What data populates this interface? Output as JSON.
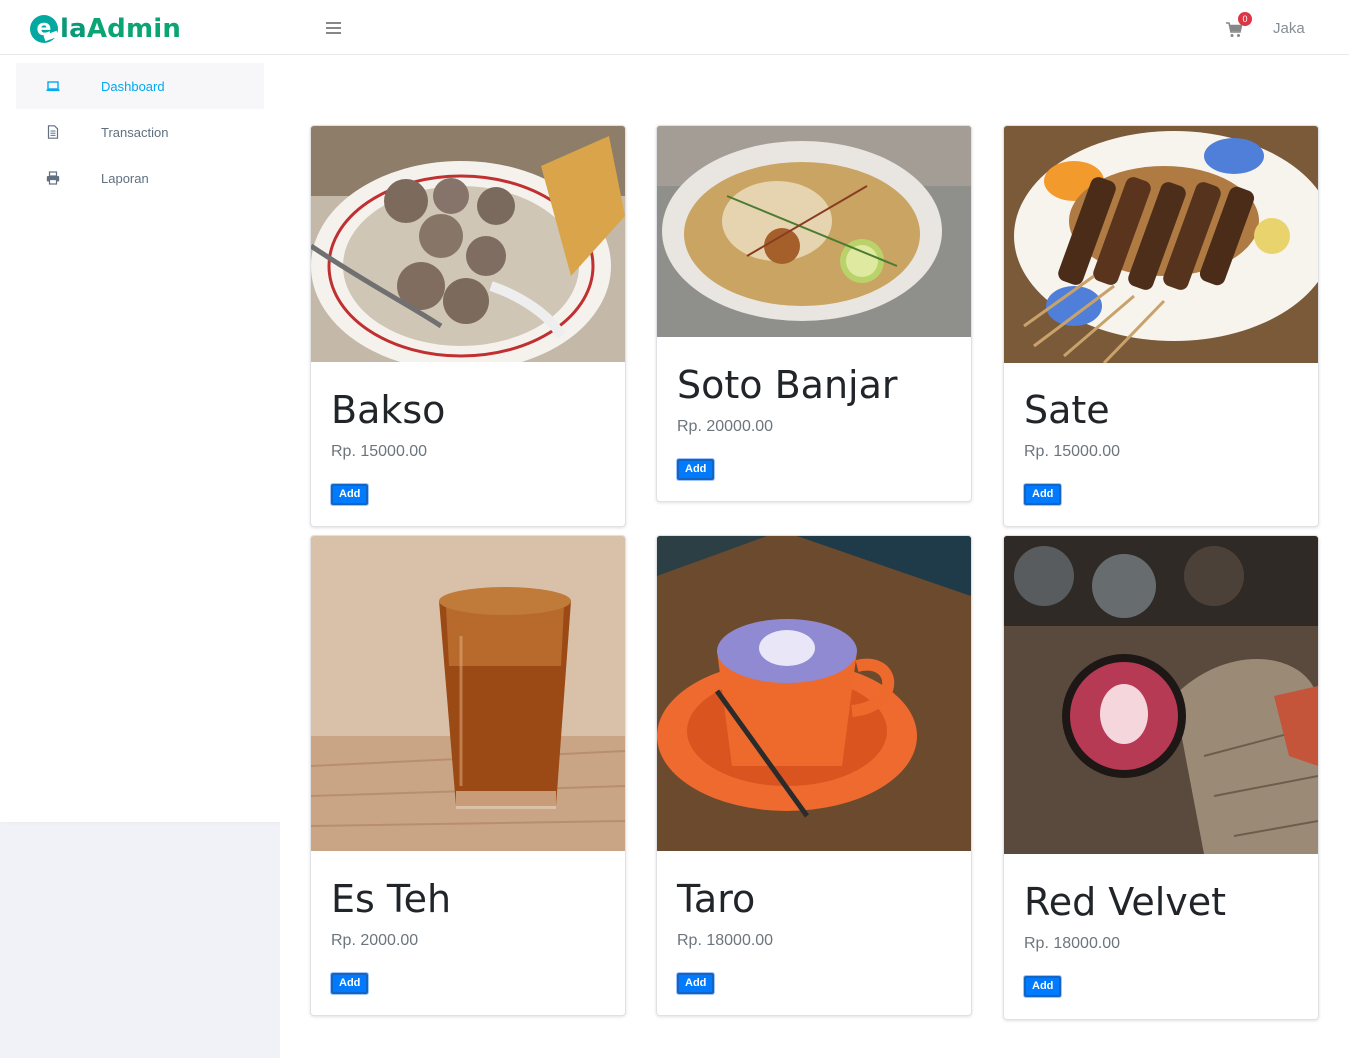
{
  "app": {
    "brand": {
      "e": "e",
      "la": "la",
      "admin": "Admin"
    }
  },
  "header": {
    "cart_count": "0",
    "user_name": "Jaka",
    "icons": [
      "menu-icon",
      "cart-icon"
    ]
  },
  "sidebar": {
    "items": [
      {
        "label": "Dashboard",
        "icon": "laptop-icon",
        "active": true
      },
      {
        "label": "Transaction",
        "icon": "file-text-icon",
        "active": false
      },
      {
        "label": "Laporan",
        "icon": "printer-icon",
        "active": false
      }
    ]
  },
  "products": [
    {
      "name": "Bakso",
      "price": "Rp. 15000.00",
      "button": "Add",
      "image": "meatball-soup-photo"
    },
    {
      "name": "Soto Banjar",
      "price": "Rp. 20000.00",
      "button": "Add",
      "image": "soto-banjar-photo"
    },
    {
      "name": "Sate",
      "price": "Rp. 15000.00",
      "button": "Add",
      "image": "satay-photo"
    },
    {
      "name": "Es Teh",
      "price": "Rp. 2000.00",
      "button": "Add",
      "image": "iced-tea-photo"
    },
    {
      "name": "Taro",
      "price": "Rp. 18000.00",
      "button": "Add",
      "image": "taro-latte-photo"
    },
    {
      "name": "Red Velvet",
      "price": "Rp. 18000.00",
      "button": "Add",
      "image": "red-velvet-latte-photo"
    }
  ],
  "colors": {
    "accent": "#03a9f3",
    "button": "#007bff",
    "badge": "#dc3545",
    "brand": "#0aa572"
  }
}
